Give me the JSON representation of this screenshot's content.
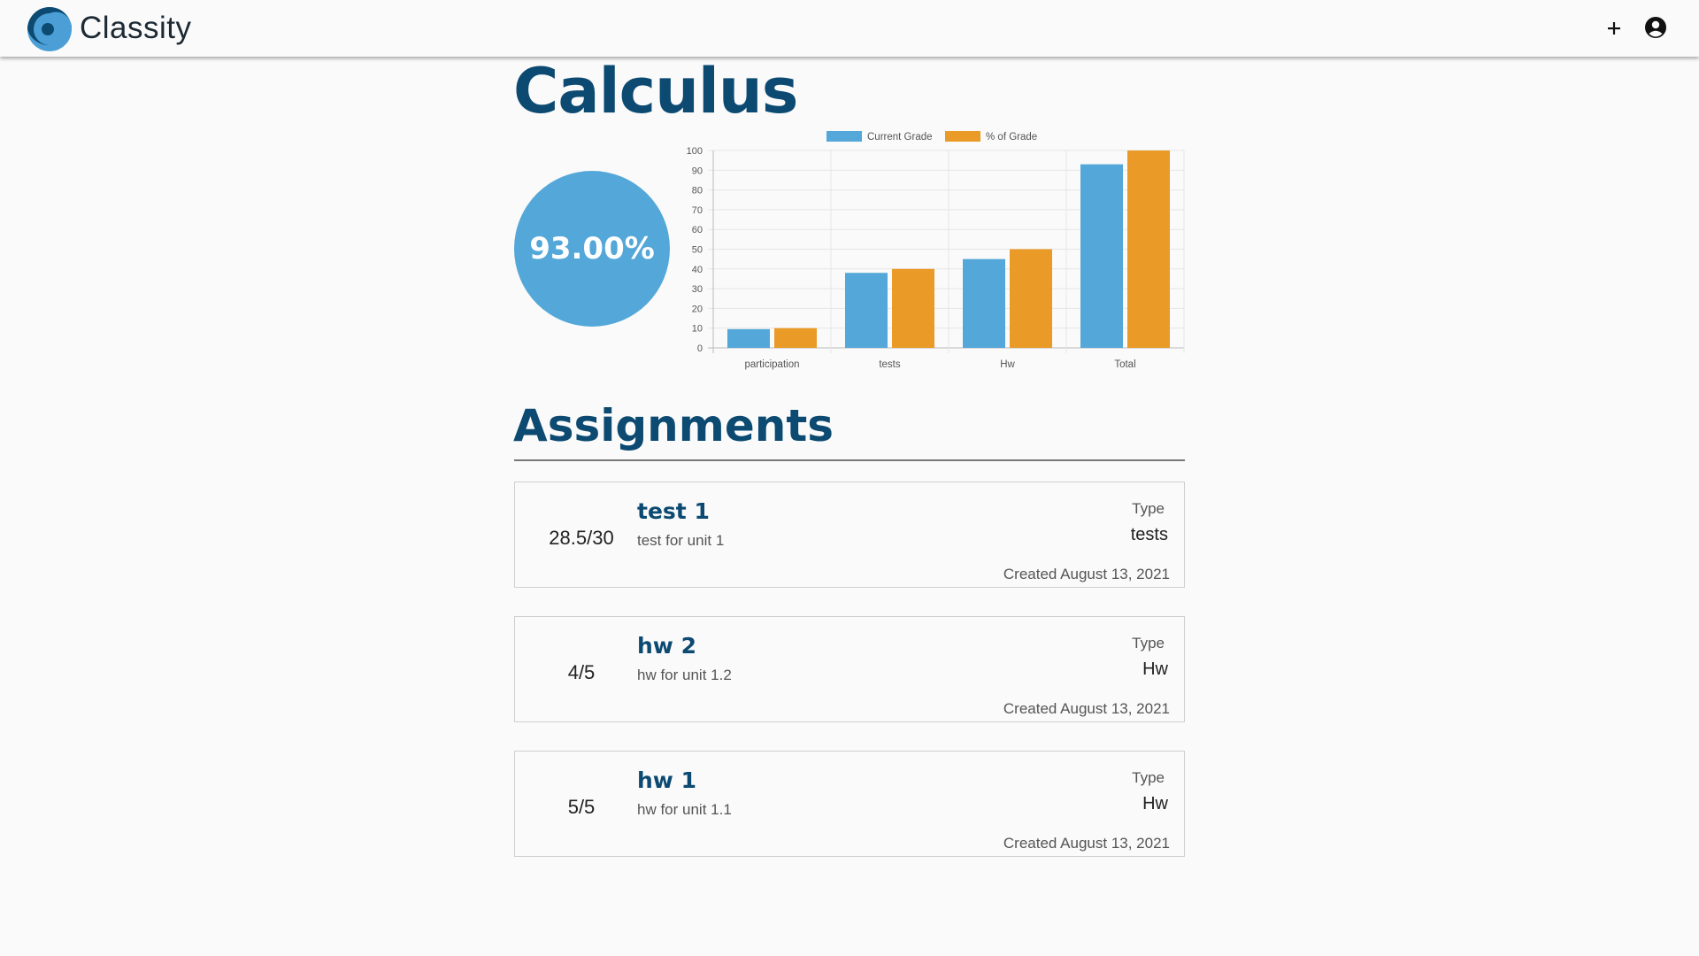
{
  "app": {
    "name": "Classity"
  },
  "header": {
    "add_icon": "plus-icon",
    "account_icon": "account-circle-icon"
  },
  "course": {
    "title": "Calculus",
    "overall_grade": "93.00%"
  },
  "colors": {
    "primary": "#0c4a72",
    "current_grade": "#54a7d9",
    "percent_of_grade": "#e99a27"
  },
  "chart_data": {
    "type": "bar",
    "categories": [
      "participation",
      "tests",
      "Hw",
      "Total"
    ],
    "series": [
      {
        "name": "Current Grade",
        "values": [
          9.5,
          38,
          45,
          93
        ],
        "color": "#54a7d9"
      },
      {
        "name": "% of Grade",
        "values": [
          10,
          40,
          50,
          100
        ],
        "color": "#e99a27"
      }
    ],
    "ylim": [
      0,
      100
    ],
    "yticks": [
      "0",
      "10",
      "20",
      "30",
      "40",
      "50",
      "60",
      "70",
      "80",
      "90",
      "100"
    ],
    "legend": "top",
    "grid": true
  },
  "assignments_section": {
    "title": "Assignments"
  },
  "assignments": [
    {
      "score": "28.5/30",
      "name": "test 1",
      "description": "test for unit 1",
      "type_label": "Type",
      "type": "tests",
      "created": "Created August 13, 2021"
    },
    {
      "score": "4/5",
      "name": "hw 2",
      "description": "hw for unit 1.2",
      "type_label": "Type",
      "type": "Hw",
      "created": "Created August 13, 2021"
    },
    {
      "score": "5/5",
      "name": "hw 1",
      "description": "hw for unit 1.1",
      "type_label": "Type",
      "type": "Hw",
      "created": "Created August 13, 2021"
    }
  ]
}
